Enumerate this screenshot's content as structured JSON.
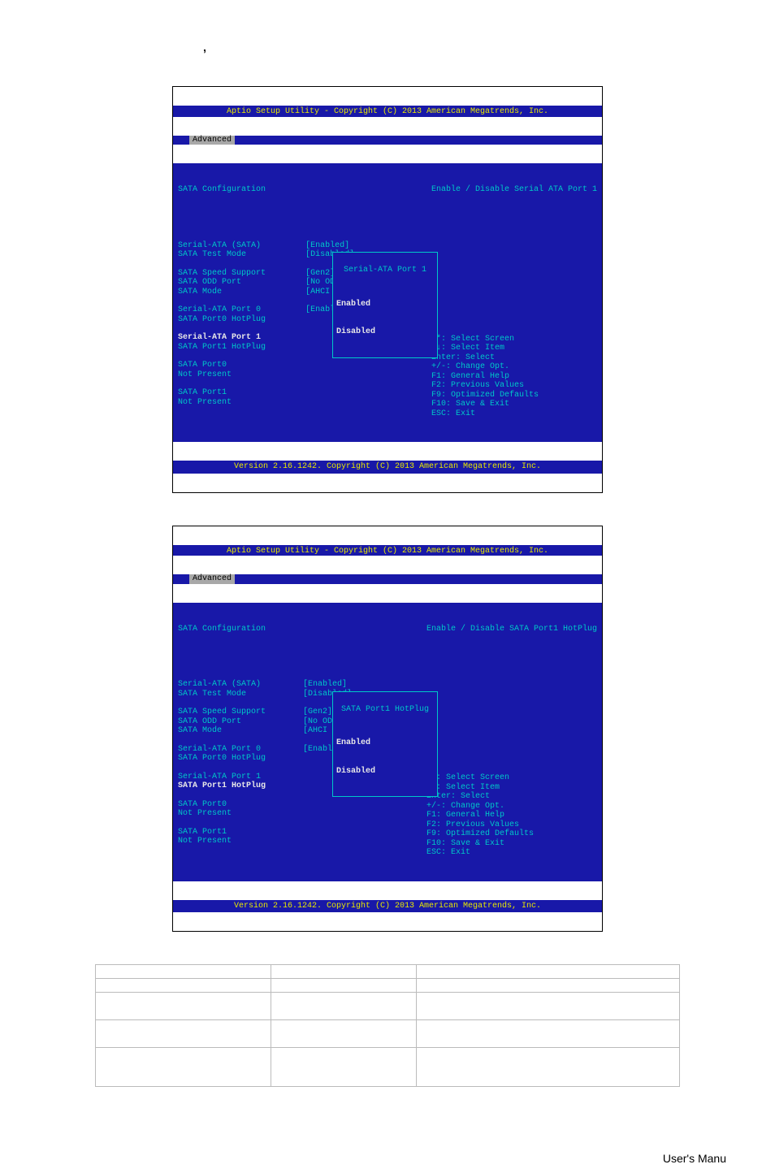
{
  "doc_comma": ",",
  "bios1": {
    "header": "Aptio Setup Utility - Copyright (C) 2013 American Megatrends, Inc.",
    "tab": "Advanced",
    "title": "SATA Configuration",
    "rows": [
      {
        "label": "Serial-ATA (SATA)",
        "value": "[Enabled]"
      },
      {
        "label": "SATA Test Mode",
        "value": "[Disabled]"
      },
      {
        "spacer": true
      },
      {
        "label": "SATA Speed Support",
        "value": "[Gen2]"
      },
      {
        "label": "SATA ODD Port",
        "value": "[No ODD]"
      },
      {
        "label": "SATA Mode",
        "value": "[AHCI Mode]"
      },
      {
        "spacer": true
      },
      {
        "label": "Serial-ATA Port 0",
        "value": "[Enabled]"
      },
      {
        "label": "SATA Port0 HotPlug",
        "value": ""
      },
      {
        "spacer": true
      },
      {
        "label": "Serial-ATA Port 1",
        "value": "",
        "white": true
      },
      {
        "label": "SATA Port1 HotPlug",
        "value": ""
      },
      {
        "spacer": true
      },
      {
        "label": "SATA Port0",
        "value": ""
      },
      {
        "label": "Not Present",
        "value": ""
      },
      {
        "spacer": true
      },
      {
        "label": "SATA Port1",
        "value": ""
      },
      {
        "label": "Not Present",
        "value": ""
      }
    ],
    "popup_title": "Serial-ATA Port 1",
    "popup_opts": [
      "Enabled",
      "Disabled"
    ],
    "help": "Enable / Disable Serial ATA Port 1",
    "hotkeys": [
      "**: Select Screen",
      "↑↓: Select Item",
      "Enter: Select",
      "+/-: Change Opt.",
      "F1: General Help",
      "F2: Previous Values",
      "F9: Optimized Defaults",
      "F10: Save & Exit",
      "ESC: Exit"
    ],
    "footer": "Version 2.16.1242. Copyright (C) 2013 American Megatrends, Inc."
  },
  "bios2": {
    "header": "Aptio Setup Utility - Copyright (C) 2013 American Megatrends, Inc.",
    "tab": "Advanced",
    "title": "SATA Configuration",
    "rows": [
      {
        "label": "Serial-ATA (SATA)",
        "value": "[Enabled]"
      },
      {
        "label": "SATA Test Mode",
        "value": "[Disabled]"
      },
      {
        "spacer": true
      },
      {
        "label": "SATA Speed Support",
        "value": "[Gen2]"
      },
      {
        "label": "SATA ODD Port",
        "value": "[No ODD]"
      },
      {
        "label": "SATA Mode",
        "value": "[AHCI Mode]"
      },
      {
        "spacer": true
      },
      {
        "label": "Serial-ATA Port 0",
        "value": "[Enabled]"
      },
      {
        "label": "SATA Port0 HotPlug",
        "value": ""
      },
      {
        "spacer": true
      },
      {
        "label": "Serial-ATA Port 1",
        "value": ""
      },
      {
        "label": "SATA Port1 HotPlug",
        "value": "",
        "white": true
      },
      {
        "spacer": true
      },
      {
        "label": "SATA Port0",
        "value": ""
      },
      {
        "label": "Not Present",
        "value": ""
      },
      {
        "spacer": true
      },
      {
        "label": "SATA Port1",
        "value": ""
      },
      {
        "label": "Not Present",
        "value": ""
      }
    ],
    "popup_title": "SATA Port1 HotPlug",
    "popup_opts": [
      "Enabled",
      "Disabled"
    ],
    "help": "Enable / Disable SATA Port1 HotPlug",
    "hotkeys": [
      "**: Select Screen",
      "↑↓: Select Item",
      "Enter: Select",
      "+/-: Change Opt.",
      "F1: General Help",
      "F2: Previous Values",
      "F9: Optimized Defaults",
      "F10: Save & Exit",
      "ESC: Exit"
    ],
    "footer": "Version 2.16.1242. Copyright (C) 2013 American Megatrends, Inc."
  },
  "table": {
    "header": [
      "",
      "",
      ""
    ],
    "rows": [
      [
        "",
        "",
        ""
      ],
      [
        "",
        "",
        ""
      ],
      [
        "",
        "",
        ""
      ],
      [
        "",
        "",
        ""
      ]
    ]
  },
  "footer_text": "User's Manu"
}
